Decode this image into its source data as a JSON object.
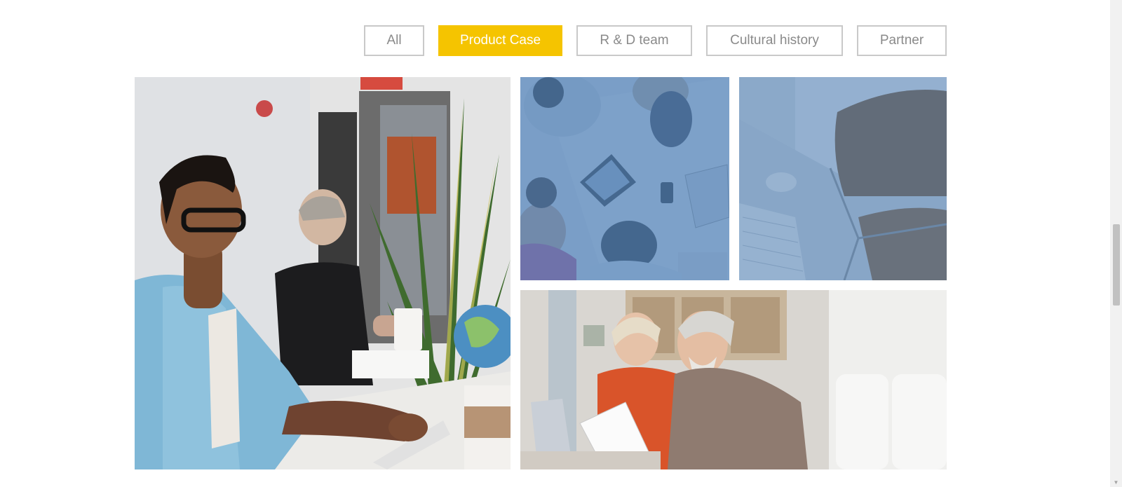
{
  "filters": [
    {
      "label": "All",
      "active": false
    },
    {
      "label": "Product Case",
      "active": true
    },
    {
      "label": "R & D team",
      "active": false
    },
    {
      "label": "Cultural history",
      "active": false
    },
    {
      "label": "Partner",
      "active": false
    }
  ],
  "gallery": {
    "items": [
      {
        "name": "photo-man-at-desk"
      },
      {
        "name": "photo-team-meeting-overhead"
      },
      {
        "name": "photo-chair-glass-desk"
      },
      {
        "name": "photo-senior-couple-documents"
      }
    ]
  },
  "colors": {
    "accent": "#f5c400",
    "button_border": "#c9c9c9",
    "button_text": "#8a8a8a",
    "photo_tint_blue": "#4f7fb5"
  }
}
